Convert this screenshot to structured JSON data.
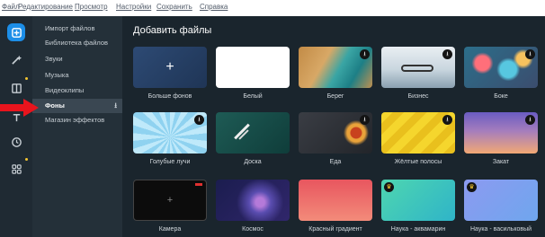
{
  "menu": [
    "Файл",
    "Редактирование",
    "Просмотр",
    "Настройки",
    "Сохранить",
    "Справка"
  ],
  "sidebar": {
    "items": [
      {
        "label": "Импорт файлов"
      },
      {
        "label": "Библиотека файлов"
      },
      {
        "label": "Звуки"
      },
      {
        "label": "Музыка"
      },
      {
        "label": "Видеоклипы"
      },
      {
        "label": "Фоны",
        "icon": "download-icon",
        "icon_glyph": "⭳"
      },
      {
        "label": "Магазин эффектов"
      }
    ]
  },
  "main": {
    "title": "Добавить файлы",
    "tiles": [
      {
        "label": "Больше фонов",
        "plus": "+"
      },
      {
        "label": "Белый"
      },
      {
        "label": "Берег"
      },
      {
        "label": "Бизнес"
      },
      {
        "label": "Боке"
      },
      {
        "label": "Голубые лучи"
      },
      {
        "label": "Доска"
      },
      {
        "label": "Еда"
      },
      {
        "label": "Жёлтые полосы"
      },
      {
        "label": "Закат"
      },
      {
        "label": "Камера",
        "plus": "+"
      },
      {
        "label": "Космос"
      },
      {
        "label": "Красный градиент"
      },
      {
        "label": "Наука - аквамарин"
      },
      {
        "label": "Наука - васильковый"
      }
    ]
  },
  "icons": {
    "download": "⭳",
    "crown": "♛"
  },
  "colors": {
    "accent": "#1c8ee8",
    "rail_bg": "#1f2a33",
    "panel_bg": "#243039",
    "main_bg": "#1a252d",
    "arrow": "#e8141d"
  }
}
